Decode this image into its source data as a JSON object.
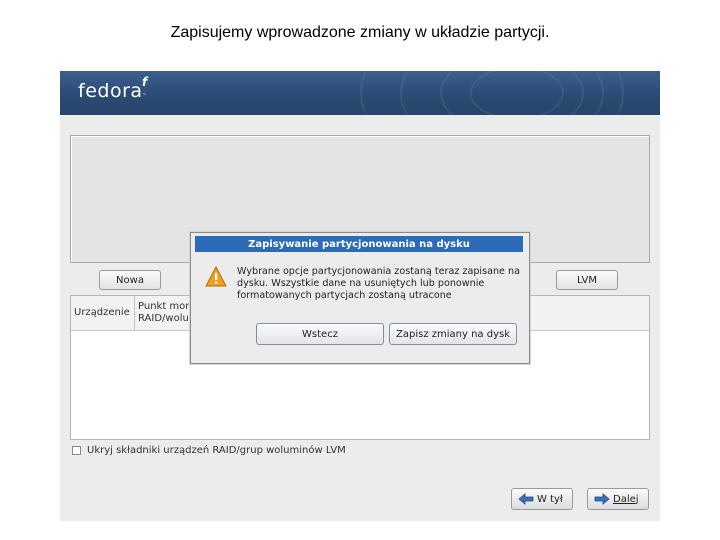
{
  "caption": "Zapisujemy wprowadzone zmiany w układzie partycji.",
  "installer": {
    "logo_text": "fedora",
    "logo_mark": "f",
    "logo_tm": "™",
    "buttons": {
      "new_label": "Nowa",
      "lvm_label": "LVM"
    },
    "table": {
      "columns": [
        {
          "label": "Urządzenie"
        },
        {
          "label": "Punkt mon",
          "label2": "RAID/wolu"
        }
      ]
    },
    "hide_raid_label": "Ukryj składniki urządzeń RAID/grup woluminów LVM",
    "nav": {
      "back_label": "W tył",
      "next_label": "Dalej"
    }
  },
  "dialog": {
    "title": "Zapisywanie partycjonowania na dysku",
    "message": "Wybrane opcje partycjonowania zostaną teraz zapisane na dysku. Wszystkie dane na usuniętych lub ponownie formatowanych partycjach zostaną utracone",
    "back_label": "Wstecz",
    "write_label": "Zapisz zmiany na dysk",
    "icon": "warning-icon",
    "accent": "#2d6bb6"
  }
}
